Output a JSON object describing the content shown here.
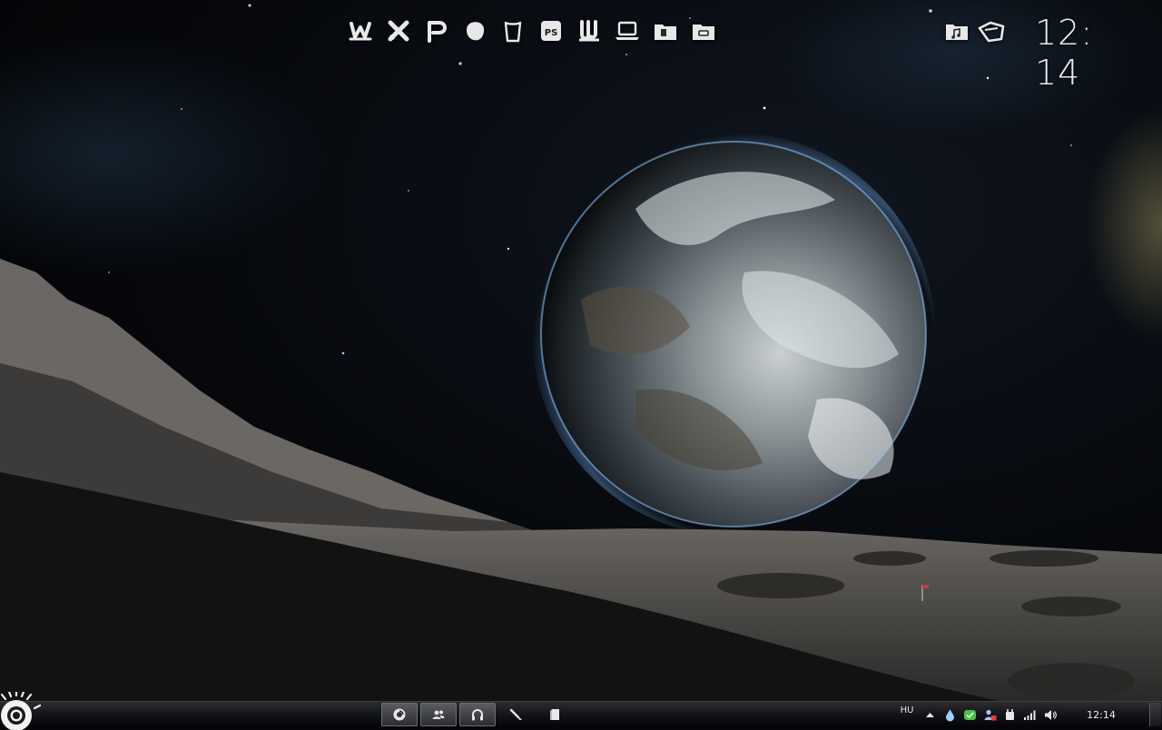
{
  "desktop": {
    "clock": "12: 14",
    "top_dock": [
      {
        "icon": "winamp-style-icon"
      },
      {
        "icon": "xfire-style-icon"
      },
      {
        "icon": "pidgin-style-icon"
      },
      {
        "icon": "blob-app-icon"
      },
      {
        "icon": "trash-bin-icon"
      },
      {
        "icon": "photoshop-icon",
        "text": "PS"
      },
      {
        "icon": "utorrent-icon"
      },
      {
        "icon": "laptop-icon"
      },
      {
        "icon": "folder-documents-icon"
      },
      {
        "icon": "folder-icon"
      }
    ],
    "right_dock": [
      {
        "icon": "music-folder-icon"
      },
      {
        "icon": "pictures-folder-icon"
      }
    ]
  },
  "taskbar": {
    "task_buttons": [
      {
        "icon": "media-player-icon",
        "active": true
      },
      {
        "icon": "contacts-icon",
        "active": true
      },
      {
        "icon": "headphones-icon",
        "active": true
      },
      {
        "icon": "brush-icon",
        "active": false
      },
      {
        "icon": "document-icon",
        "active": false
      }
    ],
    "tray": {
      "language": "HU",
      "time": "12:14",
      "icons": [
        "show-hidden-icon",
        "water-drop-icon",
        "green-chat-icon",
        "user-status-icon",
        "power-plug-icon",
        "signal-bars-icon",
        "volume-icon"
      ]
    }
  },
  "colors": {
    "taskbar": "#111215",
    "clock": "#e9edf2",
    "earth_ocean": "#2a5a86",
    "atmosphere": "#7ab8ff"
  }
}
